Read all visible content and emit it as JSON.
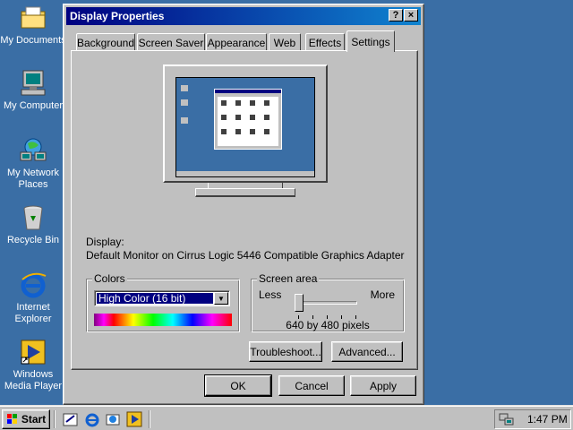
{
  "desktop": {
    "icons": [
      {
        "label_line1": "My Documents",
        "label_line2": "",
        "icon": "folder-icon"
      },
      {
        "label_line1": "My Computer",
        "label_line2": "",
        "icon": "computer-icon"
      },
      {
        "label_line1": "My Network",
        "label_line2": "Places",
        "icon": "network-icon"
      },
      {
        "label_line1": "Recycle Bin",
        "label_line2": "",
        "icon": "recycle-bin-icon"
      },
      {
        "label_line1": "Internet",
        "label_line2": "Explorer",
        "icon": "internet-explorer-icon"
      },
      {
        "label_line1": "Windows",
        "label_line2": "Media Player",
        "icon": "media-player-icon"
      }
    ],
    "background_color": "#3a6ea5"
  },
  "dialog": {
    "title": "Display Properties",
    "help_button": "?",
    "close_button": "×",
    "tabs": [
      {
        "label": "Background"
      },
      {
        "label": "Screen Saver"
      },
      {
        "label": "Appearance"
      },
      {
        "label": "Web"
      },
      {
        "label": "Effects"
      },
      {
        "label": "Settings"
      }
    ],
    "active_tab": "Settings",
    "display_label": "Display:",
    "display_value": "Default Monitor on Cirrus Logic 5446 Compatible Graphics Adapter",
    "colors": {
      "group_label": "Colors",
      "selected": "High Color (16 bit)"
    },
    "screen_area": {
      "group_label": "Screen area",
      "less": "Less",
      "more": "More",
      "resolution": "640 by 480 pixels",
      "slider_position": 0
    },
    "troubleshoot_button": "Troubleshoot...",
    "advanced_button": "Advanced...",
    "ok_button": "OK",
    "cancel_button": "Cancel",
    "apply_button": "Apply"
  },
  "taskbar": {
    "start_label": "Start",
    "clock": "1:47 PM",
    "quick_launch": [
      "show-desktop-icon",
      "internet-explorer-icon",
      "outlook-express-icon",
      "media-player-icon"
    ]
  },
  "colors": {
    "title_active_start": "#000080",
    "title_active_end": "#1084d0",
    "face": "#c0c0c0",
    "selection": "#000080"
  }
}
